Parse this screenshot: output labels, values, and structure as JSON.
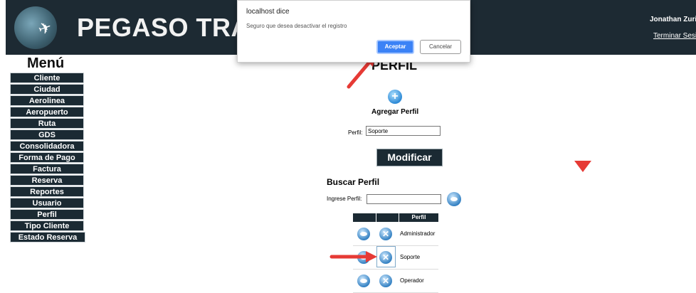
{
  "header": {
    "brand": "PEGASO TRAVE",
    "user_name": "Jonathan Zurita",
    "logout_label": "Terminar Sesión"
  },
  "menu": {
    "title": "Menú",
    "items": [
      "Cliente",
      "Ciudad",
      "Aerolinea",
      "Aeropuerto",
      "Ruta",
      "GDS",
      "Consolidadora",
      "Forma de Pago",
      "Factura",
      "Reserva",
      "Reportes",
      "Usuario",
      "Perfil",
      "Tipo Cliente",
      "Estado Reserva"
    ]
  },
  "main": {
    "title": "PERFIL",
    "add_label": "Agregar Perfil",
    "perfil_label": "Perfil:",
    "perfil_value": "Soporte",
    "modify_label": "Modificar",
    "search_title": "Buscar Perfil",
    "search_label": "Ingrese Perfil:",
    "search_value": ""
  },
  "table": {
    "header": "Perfil",
    "rows": [
      "Administrador",
      "Soporte",
      "Operador"
    ]
  },
  "dialog": {
    "title": "localhost dice",
    "message": "Seguro que desea desactivar el registro",
    "accept_label": "Aceptar",
    "cancel_label": "Cancelar"
  },
  "colors": {
    "header_bg": "#1d2a33",
    "accent": "#3b82f6",
    "annotation_arrow": "#e63a35"
  }
}
